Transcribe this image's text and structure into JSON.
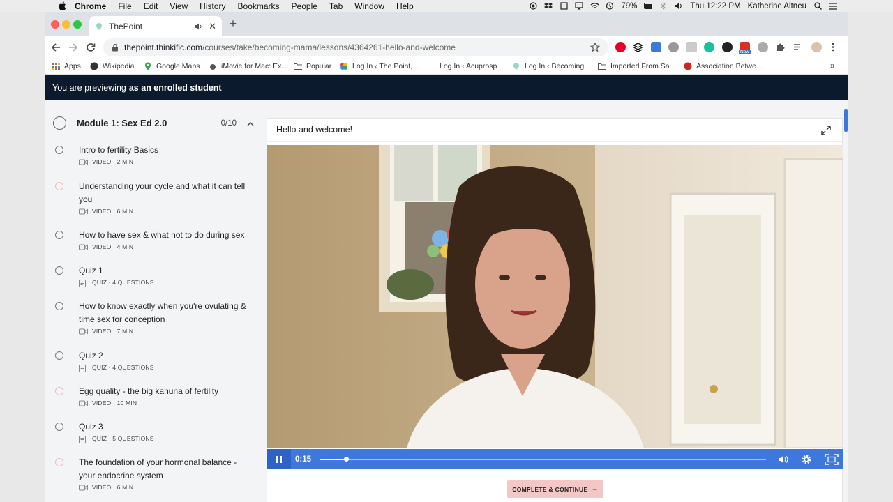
{
  "menubar": {
    "items": [
      "Chrome",
      "File",
      "Edit",
      "View",
      "History",
      "Bookmarks",
      "People",
      "Tab",
      "Window",
      "Help"
    ],
    "battery": "79%",
    "clock": "Thu 12:22 PM",
    "user": "Katherine Altneu"
  },
  "tab": {
    "title": "ThePoint"
  },
  "address": {
    "host": "thepoint.thinkific.com",
    "path": "/courses/take/becoming-mama/lessons/4364261-hello-and-welcome"
  },
  "bookmarks": [
    "Apps",
    "Wikipedia",
    "Google Maps",
    "iMovie for Mac: Ex...",
    "Popular",
    "Log In ‹ The Point,...",
    "Log In ‹ Acuprosp...",
    "Log In ‹ Becoming...",
    "Imported From Sa...",
    "Association Betwe..."
  ],
  "extensions_badge": "New",
  "preview_bar": {
    "prefix": "You are previewing",
    "mode": "as an enrolled student"
  },
  "module": {
    "title": "Module 1: Sex Ed 2.0",
    "progress": "0/10"
  },
  "lessons": [
    {
      "title": "Intro to fertility Basics",
      "meta": "VIDEO · 2 MIN",
      "kind": "video",
      "pink": false
    },
    {
      "title": "Understanding your cycle and what it can tell you",
      "meta": "VIDEO · 6 MIN",
      "kind": "video",
      "pink": true
    },
    {
      "title": "How to have sex & what not to do during sex",
      "meta": "VIDEO · 4 MIN",
      "kind": "video",
      "pink": false
    },
    {
      "title": "Quiz 1",
      "meta": "QUIZ · 4 QUESTIONS",
      "kind": "quiz",
      "pink": false
    },
    {
      "title": "How to know exactly when you're ovulating & time sex for conception",
      "meta": "VIDEO · 7 MIN",
      "kind": "video",
      "pink": false
    },
    {
      "title": "Quiz 2",
      "meta": "QUIZ · 4 QUESTIONS",
      "kind": "quiz",
      "pink": false
    },
    {
      "title": "Egg quality - the big kahuna of fertility",
      "meta": "VIDEO · 10 MIN",
      "kind": "video",
      "pink": true
    },
    {
      "title": "Quiz 3",
      "meta": "QUIZ · 5 QUESTIONS",
      "kind": "quiz",
      "pink": false
    },
    {
      "title": "The foundation of your hormonal balance - your endocrine system",
      "meta": "VIDEO · 6 MIN",
      "kind": "video",
      "pink": true
    }
  ],
  "player": {
    "lesson_title": "Hello and welcome!",
    "time": "0:15",
    "progress": 0.06
  },
  "complete_button": {
    "label": "COMPLETE & CONTINUE",
    "arrow": "→"
  },
  "colors": {
    "preview_bar": "#0b1a2c",
    "player_controls": "#3f78dc",
    "complete_button": "#f2c7c5"
  }
}
